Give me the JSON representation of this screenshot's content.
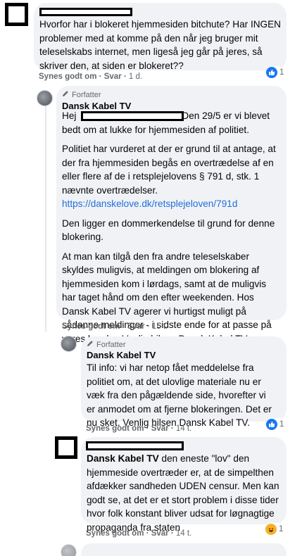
{
  "comment1": {
    "text": "Hvorfor har i blokeret hjemmesiden bitchute? Har INGEN problemer med at komme på den når jeg bruger mit teleselskabs internet, men ligeså jeg går på jeres, så skriver den, at siden er blokeret??",
    "like": "Synes godt om",
    "reply": "Svar",
    "time": "1 d.",
    "reaction_count": "1"
  },
  "reply1": {
    "author_badge": "Forfatter",
    "name": "Dansk Kabel TV",
    "greeting": "Hej",
    "greeting_rest": "Den 29/5 er vi blevet bedt om at lukke for hjemmesiden af politiet.",
    "p2": "Politiet har vurderet at der er grund til at antage, at der fra hjemmesiden begås en overtrædelse af en eller flere af de i retsplejelovens § 791 d, stk. 1 nævnte overtrædelser.",
    "link": "https://danskelove.dk/retsplejeloven/791d",
    "p3": "Den ligger en dommerkendelse til grund for denne blokering.",
    "p4": "At man kan tilgå den fra andre teleselskaber skyldes muligvis, at meldingen om blokering af hjemmesiden kom i lørdags, samt at de muligvis har taget hånd om den efter weekenden. Hos Dansk Kabel TV agerer vi hurtigst muligt på sådanne meldinger - i sidste ende for at passe på vores kunder. Venlig hilsen Dansk Kabel TV",
    "like": "Synes godt om",
    "reply": "Svar",
    "time": "15 t."
  },
  "reply2": {
    "author_badge": "Forfatter",
    "name": "Dansk Kabel TV",
    "text": "Til info: vi har netop fået meddelelse fra politiet om, at det ulovlige materiale nu er væk fra den pågældende side, hvorefter vi er anmodet om at fjerne blokeringen. Det er nu sket. Venlig hilsen Dansk Kabel TV.",
    "like": "Synes godt om",
    "reply": "Svar",
    "time": "14 t.",
    "reaction_count": "1"
  },
  "reply3": {
    "mention": "Dansk Kabel TV",
    "text": " den eneste \"lov\" den hjemmeside overtræder er, at de simpelthen afdækker sandheden UDEN censur. Men kan godt se, at det er et stort problem i disse tider hvor folk konstant bliver udsat for løgnagtige propaganda fra staten",
    "like": "Synes godt om",
    "reply": "Svar",
    "time": "14 t.",
    "reaction_count": "1"
  },
  "sep": "·",
  "icons": {
    "like": "thumbs-up-icon",
    "haha": "laughing-face-icon",
    "author": "pencil-icon"
  },
  "colors": {
    "bubble": "#f0f2f5",
    "link": "#216fdb",
    "like": "#1877f2",
    "haha": "#f7b125"
  }
}
